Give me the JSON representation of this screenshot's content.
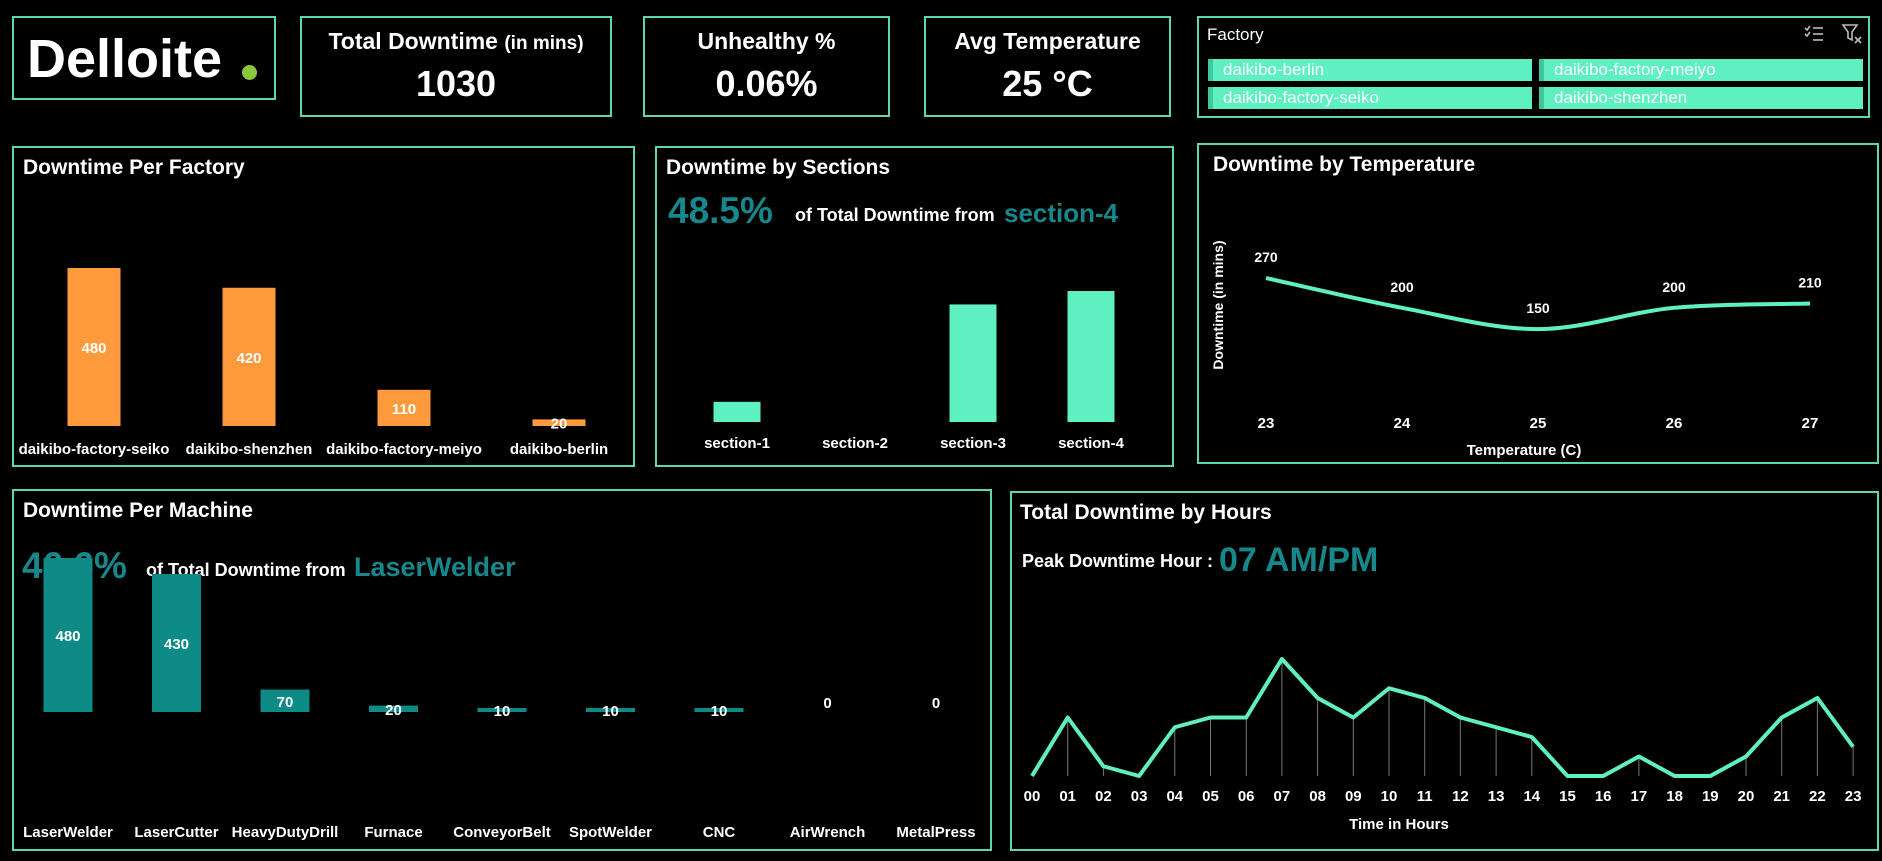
{
  "logo": {
    "text": "Delloite",
    "dot_color": "#8dc63f"
  },
  "kpis": {
    "downtime": {
      "label": "Total Downtime",
      "label_small": "(in mins)",
      "value": "1030"
    },
    "unhealthy": {
      "label": "Unhealthy %",
      "value": "0.06%"
    },
    "avg_temp": {
      "label": "Avg Temperature",
      "value": "25 °C"
    }
  },
  "slicer": {
    "title": "Factory",
    "items": [
      "daikibo-berlin",
      "daikibo-factory-meiyo",
      "daikibo-factory-seiko",
      "daikibo-shenzhen"
    ],
    "multiselect_icon": "multi-select-icon",
    "clear_filter_icon": "clear-filter-icon"
  },
  "colors": {
    "accent": "#5ef0c0",
    "border": "#5fd6b0",
    "orange": "#ff9a3c",
    "teal": "#0e8a87",
    "highlight_text": "#16878a"
  },
  "factory_panel": {
    "title": "Downtime Per Factory"
  },
  "sections_panel": {
    "title": "Downtime by Sections",
    "pct": "48.5%",
    "of_text": "of Total Downtime from",
    "highlight": "section-4"
  },
  "temp_panel": {
    "title": "Downtime by Temperature"
  },
  "machine_panel": {
    "title": "Downtime Per Machine",
    "pct": "46.6%",
    "of_text": "of Total Downtime from",
    "highlight": "LaserWelder"
  },
  "hours_panel": {
    "title": "Total Downtime by Hours",
    "peak_label": "Peak Downtime Hour :",
    "peak_value": "07 AM/PM"
  },
  "chart_data": [
    {
      "id": "factory",
      "type": "bar",
      "categories": [
        "daikibo-factory-seiko",
        "daikibo-shenzhen",
        "daikibo-factory-meiyo",
        "daikibo-berlin"
      ],
      "values": [
        480,
        420,
        110,
        20
      ],
      "data_labels": [
        "480",
        "420",
        "110",
        "20"
      ],
      "ylim": [
        0,
        480
      ],
      "color": "#ff9a3c"
    },
    {
      "id": "sections",
      "type": "bar",
      "categories": [
        "section-1",
        "section-2",
        "section-3",
        "section-4"
      ],
      "values": [
        60,
        0,
        350,
        390
      ],
      "ylim": [
        0,
        390
      ],
      "color": "#5ef0c0"
    },
    {
      "id": "temperature",
      "type": "line",
      "x": [
        "23",
        "24",
        "25",
        "26",
        "27"
      ],
      "values": [
        270,
        200,
        150,
        200,
        210
      ],
      "data_labels": [
        "270",
        "200",
        "150",
        "200",
        "210"
      ],
      "xlabel": "Temperature (C)",
      "ylabel": "Downtime (in mins)",
      "ylim": [
        0,
        270
      ],
      "color": "#5ef0c0"
    },
    {
      "id": "machine",
      "type": "bar",
      "categories": [
        "LaserWelder",
        "LaserCutter",
        "HeavyDutyDrill",
        "Furnace",
        "ConveyorBelt",
        "SpotWelder",
        "CNC",
        "AirWrench",
        "MetalPress"
      ],
      "values": [
        480,
        430,
        70,
        20,
        10,
        10,
        10,
        0,
        0
      ],
      "data_labels": [
        "480",
        "430",
        "70",
        "20",
        "10",
        "10",
        "10",
        "0",
        "0"
      ],
      "ylim": [
        0,
        480
      ],
      "color": "#0e8a87"
    },
    {
      "id": "hours",
      "type": "line",
      "x": [
        "00",
        "01",
        "02",
        "03",
        "04",
        "05",
        "06",
        "07",
        "08",
        "09",
        "10",
        "11",
        "12",
        "13",
        "14",
        "15",
        "16",
        "17",
        "18",
        "19",
        "20",
        "21",
        "22",
        "23"
      ],
      "values": [
        0,
        60,
        10,
        0,
        50,
        60,
        60,
        120,
        80,
        60,
        90,
        80,
        60,
        50,
        40,
        0,
        0,
        20,
        0,
        0,
        20,
        60,
        80,
        30
      ],
      "xlabel": "Time in Hours",
      "ylim": [
        0,
        120
      ],
      "color": "#5ef0c0"
    }
  ]
}
